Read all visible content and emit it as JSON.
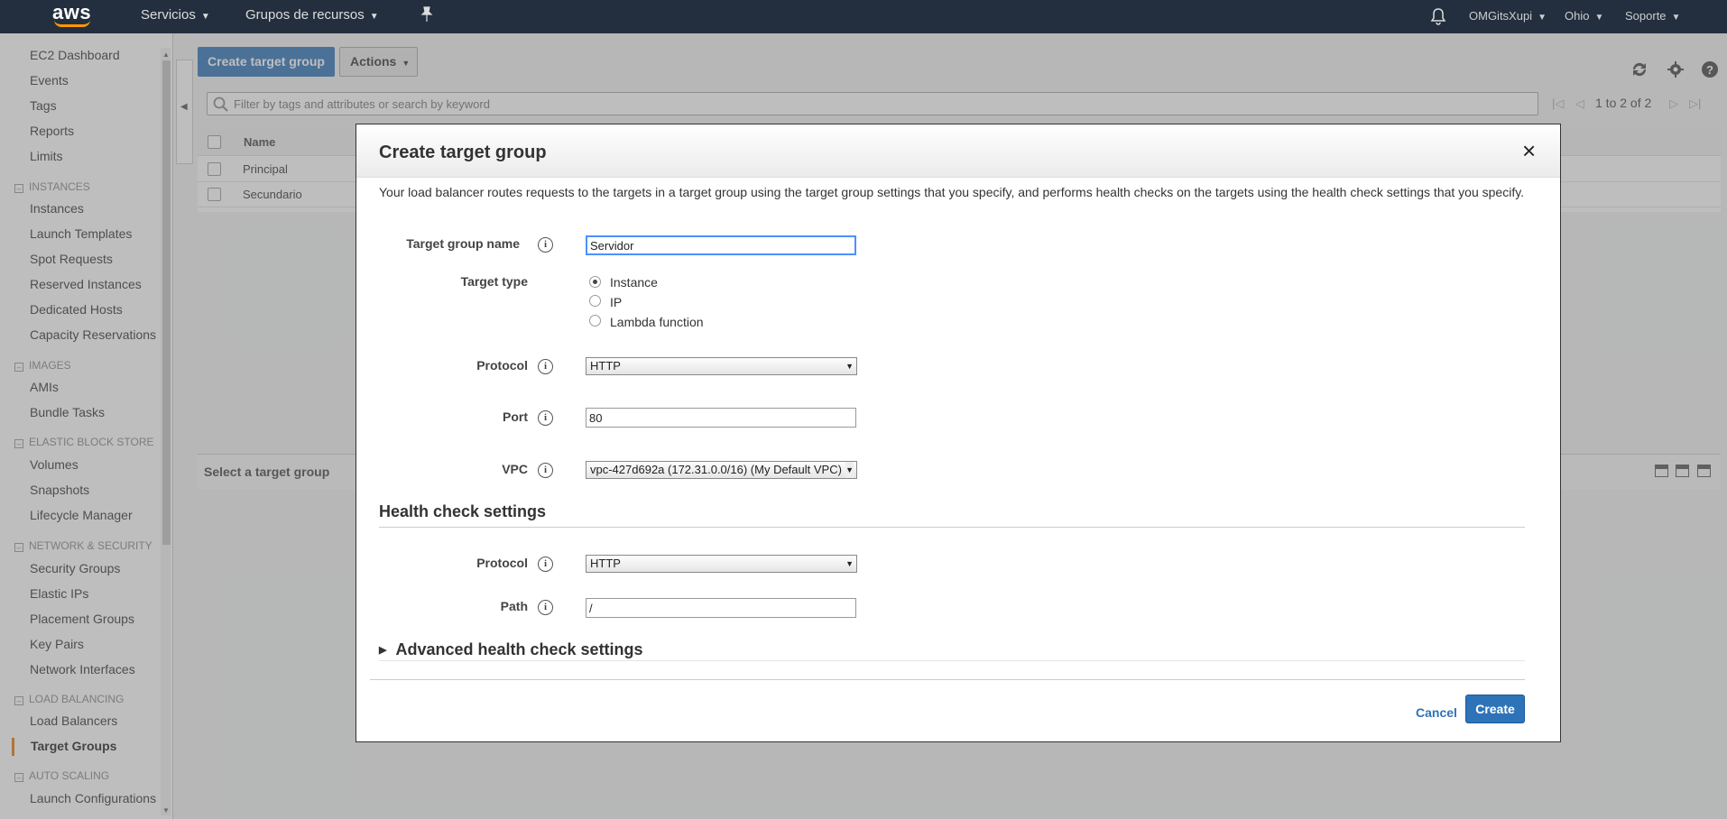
{
  "topnav": {
    "logo": "aws",
    "services": "Servicios",
    "resource_groups": "Grupos de recursos",
    "account": "OMGitsXupi",
    "region": "Ohio",
    "support": "Soporte"
  },
  "sidebar": {
    "top_items": [
      "EC2 Dashboard",
      "Events",
      "Tags",
      "Reports",
      "Limits"
    ],
    "instances_header": "INSTANCES",
    "instances_items": [
      "Instances",
      "Launch Templates",
      "Spot Requests",
      "Reserved Instances",
      "Dedicated Hosts",
      "Capacity Reservations"
    ],
    "images_header": "IMAGES",
    "images_items": [
      "AMIs",
      "Bundle Tasks"
    ],
    "ebs_header": "ELASTIC BLOCK STORE",
    "ebs_items": [
      "Volumes",
      "Snapshots",
      "Lifecycle Manager"
    ],
    "network_header": "NETWORK & SECURITY",
    "network_items": [
      "Security Groups",
      "Elastic IPs",
      "Placement Groups",
      "Key Pairs",
      "Network Interfaces"
    ],
    "lb_header": "LOAD BALANCING",
    "lb_items": [
      "Load Balancers",
      "Target Groups"
    ],
    "as_header": "AUTO SCALING",
    "as_items": [
      "Launch Configurations"
    ]
  },
  "toolbar": {
    "create_label": "Create target group",
    "actions_label": "Actions"
  },
  "search": {
    "placeholder": "Filter by tags and attributes or search by keyword"
  },
  "pager": {
    "text": "1 to 2 of 2"
  },
  "table": {
    "header_name": "Name",
    "rows": [
      "Principal",
      "Secundario"
    ]
  },
  "detail": {
    "title": "Select a target group"
  },
  "modal": {
    "title": "Create target group",
    "close": "×",
    "description": "Your load balancer routes requests to the targets in a target group using the target group settings that you specify, and performs health checks on the targets using the health check settings that you specify.",
    "name_label": "Target group name",
    "name_value": "Servidor",
    "type_label": "Target type",
    "type_options": [
      "Instance",
      "IP",
      "Lambda function"
    ],
    "protocol_label": "Protocol",
    "protocol_value": "HTTP",
    "port_label": "Port",
    "port_value": "80",
    "vpc_label": "VPC",
    "vpc_value": "vpc-427d692a (172.31.0.0/16) (My Default VPC)",
    "health_title": "Health check settings",
    "hc_protocol_label": "Protocol",
    "hc_protocol_value": "HTTP",
    "path_label": "Path",
    "path_value": "/",
    "advanced_label": "Advanced health check settings",
    "cancel_label": "Cancel",
    "create_label": "Create",
    "info_glyph": "i"
  }
}
